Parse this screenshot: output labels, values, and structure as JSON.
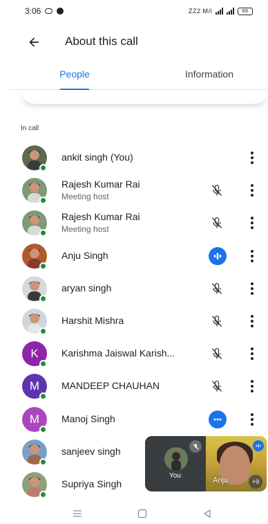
{
  "status_bar": {
    "time": "3:06",
    "network_text": "ZZ2 M/l",
    "battery": "88"
  },
  "app_bar": {
    "title": "About this call",
    "back_icon": "arrow-back-icon"
  },
  "tabs": [
    {
      "label": "People",
      "selected": true
    },
    {
      "label": "Information",
      "selected": false
    }
  ],
  "section_label": "In call",
  "participants": [
    {
      "name": "ankit singh (You)",
      "subtitle": "",
      "avatar": "photo",
      "mic": "none"
    },
    {
      "name": "Rajesh Kumar Rai",
      "subtitle": "Meeting host",
      "avatar": "photo",
      "mic": "muted"
    },
    {
      "name": "Rajesh Kumar Rai",
      "subtitle": "Meeting host",
      "avatar": "photo",
      "mic": "muted"
    },
    {
      "name": "Anju Singh",
      "subtitle": "",
      "avatar": "photo",
      "mic": "speaking"
    },
    {
      "name": "aryan singh",
      "subtitle": "",
      "avatar": "photo",
      "mic": "muted"
    },
    {
      "name": "Harshit Mishra",
      "subtitle": "",
      "avatar": "photo",
      "mic": "muted"
    },
    {
      "name": "Karishma Jaiswal Karish...",
      "subtitle": "",
      "avatar": "letter",
      "letter": "K",
      "color": "#8e24aa",
      "mic": "muted"
    },
    {
      "name": "MANDEEP CHAUHAN",
      "subtitle": "",
      "avatar": "letter",
      "letter": "M",
      "color": "#5e35b1",
      "mic": "muted"
    },
    {
      "name": "Manoj Singh",
      "subtitle": "",
      "avatar": "letter",
      "letter": "M",
      "color": "#ab47bc",
      "mic": "active"
    },
    {
      "name": "sanjeev singh",
      "subtitle": "",
      "avatar": "photo",
      "mic": "none"
    },
    {
      "name": "Supriya Singh",
      "subtitle": "",
      "avatar": "photo",
      "mic": "none"
    }
  ],
  "pip": {
    "self_label": "You",
    "other_name": "Anju",
    "more_count": "+9"
  },
  "colors": {
    "accent": "#1a73e8",
    "presence": "#1e8e3e"
  }
}
